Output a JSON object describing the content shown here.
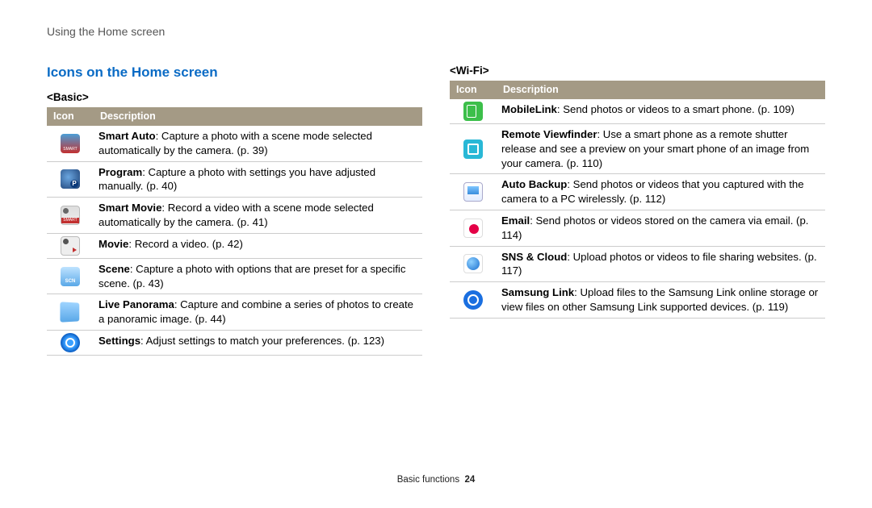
{
  "breadcrumb": "Using the Home screen",
  "title": "Icons on the Home screen",
  "th_icon": "Icon",
  "th_desc": "Description",
  "basic_label": "<Basic>",
  "wifi_label": "<Wi-Fi>",
  "basic": [
    {
      "icon": "smart-auto",
      "bold": "Smart Auto",
      "text": ": Capture a photo with a scene mode selected automatically by the camera. (p. 39)"
    },
    {
      "icon": "program",
      "bold": "Program",
      "text": ": Capture a photo with settings you have adjusted manually. (p. 40)"
    },
    {
      "icon": "smart-movie",
      "bold": "Smart Movie",
      "text": ": Record a video with a scene mode selected automatically by the camera. (p. 41)"
    },
    {
      "icon": "movie",
      "bold": "Movie",
      "text": ": Record a video. (p. 42)"
    },
    {
      "icon": "scene",
      "bold": "Scene",
      "text": ": Capture a photo with options that are preset for a specific scene. (p. 43)"
    },
    {
      "icon": "panorama",
      "bold": "Live Panorama",
      "text": ": Capture and combine a series of photos to create a panoramic image. (p. 44)"
    },
    {
      "icon": "settings",
      "bold": "Settings",
      "text": ": Adjust settings to match your preferences. (p. 123)"
    }
  ],
  "wifi": [
    {
      "icon": "mobilelink",
      "bold": "MobileLink",
      "text": ": Send photos or videos to a smart phone. (p. 109)"
    },
    {
      "icon": "remoteview",
      "bold": "Remote Viewfinder",
      "text": ": Use a smart phone as a remote shutter release and see a preview on your smart phone of an image from your camera. (p. 110)"
    },
    {
      "icon": "autobackup",
      "bold": "Auto Backup",
      "text": ": Send photos or videos that you captured with the camera to a PC wirelessly. (p. 112)"
    },
    {
      "icon": "email",
      "bold": "Email",
      "text": ": Send photos or videos stored on the camera via email. (p. 114)"
    },
    {
      "icon": "snscloud",
      "bold": "SNS & Cloud",
      "text": ": Upload photos or videos to file sharing websites. (p. 117)"
    },
    {
      "icon": "samsunglink",
      "bold": "Samsung Link",
      "text": ": Upload files to the Samsung Link online storage or view files on other Samsung Link supported devices. (p. 119)"
    }
  ],
  "footer_section": "Basic functions",
  "footer_page": "24"
}
